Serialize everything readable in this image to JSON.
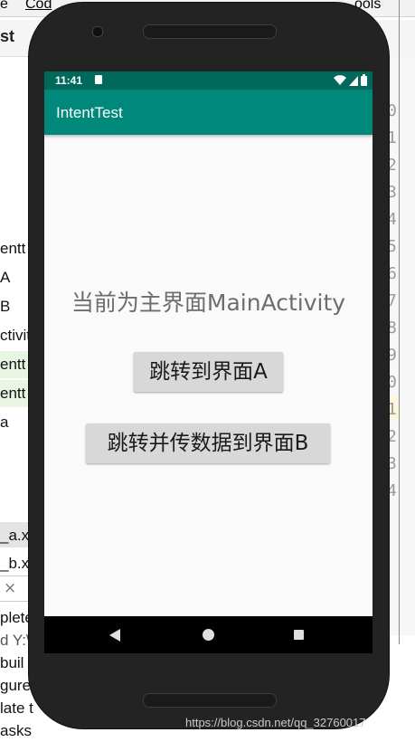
{
  "ide": {
    "menu": [
      "e",
      "Cod",
      "ools"
    ],
    "breadcrumb": "st",
    "tree_items": [
      "entt",
      "A",
      "B",
      "ctivit",
      "entt",
      "entt",
      "a"
    ],
    "tabs": [
      "_a.xn",
      "_b.xn"
    ],
    "close_glyph": "×",
    "console_lines": [
      "plete",
      "d Y:\\",
      "buil",
      "gure",
      "late t",
      "asks"
    ],
    "line_numbers": [
      "0",
      "1",
      "2",
      "3",
      "4",
      "5",
      "6",
      "7",
      "8",
      "9",
      "0",
      "1",
      "2",
      "3",
      "4"
    ]
  },
  "watermark": "https://blog.csdn.net/qq_32760017",
  "phone": {
    "status_bar": {
      "time": "11:41"
    },
    "app_bar": {
      "title": "IntentTest"
    },
    "content": {
      "current_screen_text": "当前为主界面MainActivity",
      "button_a_label": "跳转到界面A",
      "button_b_label": "跳转并传数据到界面B"
    },
    "nav_bar": {
      "back": "back-icon",
      "home": "home-icon",
      "recents": "recents-icon"
    }
  },
  "colors": {
    "status_bar": "#00695c",
    "app_bar": "#00897b",
    "screen_bg": "#fafafa",
    "button_bg": "#d8d8d8"
  }
}
